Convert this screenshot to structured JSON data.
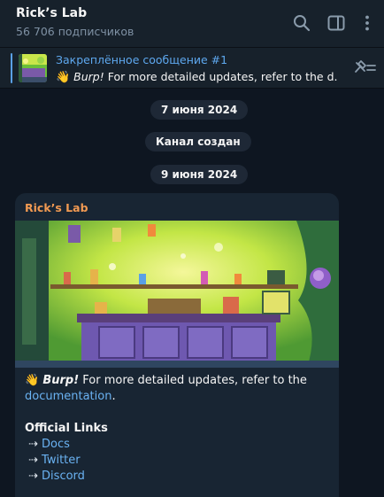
{
  "header": {
    "title": "Rick’s Lab",
    "subtitle": "56 706 подписчиков",
    "icons": [
      "search-icon",
      "sidebar-toggle-icon",
      "more-vertical-icon"
    ]
  },
  "pinned": {
    "title": "Закреплённое сообщение #1",
    "emoji": "👋",
    "burp": "Burp!",
    "text": " For more detailed updates, refer to the d..."
  },
  "dates": {
    "first": "7 июня 2024",
    "channel_created": "Канал создан",
    "second": "9 июня 2024"
  },
  "message": {
    "author": "Rick’s Lab",
    "emoji": "👋",
    "burp": "Burp!",
    "text_before_link": " For more detailed updates, refer to the",
    "link": "documentation",
    "text_after_link": ".",
    "links_heading": "Official Links",
    "links": [
      {
        "arrow": "⇢",
        "label": "Docs"
      },
      {
        "arrow": "⇢",
        "label": "Twitter"
      },
      {
        "arrow": "⇢",
        "label": "Discord"
      }
    ]
  },
  "colors": {
    "background": "#0e1621",
    "header": "#17212b",
    "bubble": "#182533",
    "accent": "#5ea8ef",
    "author": "#f19a52"
  }
}
